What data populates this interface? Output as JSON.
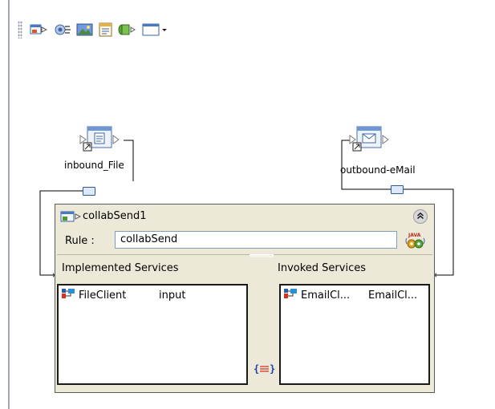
{
  "toolbar": {
    "buttons": [
      {
        "icon": "add-component-icon"
      },
      {
        "icon": "connect-icon"
      },
      {
        "icon": "image-icon"
      },
      {
        "icon": "properties-icon"
      },
      {
        "icon": "plug-icon"
      },
      {
        "icon": "window-dropdown-icon"
      }
    ]
  },
  "nodes": {
    "inbound": {
      "label": "inbound_File",
      "icon": "file-external-icon"
    },
    "outbound": {
      "label": "outbound-eMail",
      "icon": "email-external-icon"
    }
  },
  "collab": {
    "title": "collabSend1",
    "rule_label": "Rule :",
    "rule_value": "collabSend",
    "java_badge": "JAVA",
    "implemented": {
      "title": "Implemented Services",
      "rows": [
        {
          "name": "FileClient",
          "operation": "input"
        }
      ]
    },
    "invoked": {
      "title": "Invoked Services",
      "rows": [
        {
          "name": "EmailCl...",
          "operation": "EmailCl..."
        }
      ]
    }
  },
  "colors": {
    "panel_bg": "#ece9d8",
    "port_blue": "#2b5aa8",
    "connector": "#000000"
  }
}
